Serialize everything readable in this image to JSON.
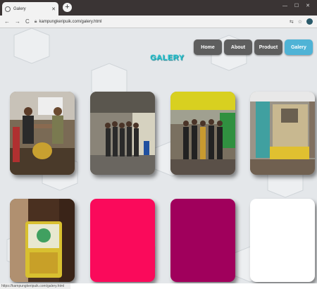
{
  "browser": {
    "tab_title": "Galery",
    "url": "kampungkeripuik.com/galery.html",
    "status_url": "https://kampungkeripuik.com/galery.html"
  },
  "nav": {
    "items": [
      {
        "label": "Home",
        "active": false
      },
      {
        "label": "About",
        "active": false
      },
      {
        "label": "Product",
        "active": false
      },
      {
        "label": "Galery",
        "active": true
      }
    ]
  },
  "page": {
    "title": "GALERY"
  },
  "gallery": {
    "items": [
      {
        "kind": "photo",
        "subject": "handshake-photo"
      },
      {
        "kind": "photo",
        "subject": "group-photo"
      },
      {
        "kind": "photo",
        "subject": "group-photo-2"
      },
      {
        "kind": "photo",
        "subject": "shop-photo"
      },
      {
        "kind": "photo",
        "subject": "product-package-photo"
      },
      {
        "kind": "color",
        "color": "#fa0a5b"
      },
      {
        "kind": "color",
        "color": "#a0005c"
      },
      {
        "kind": "color",
        "color": "#ffffff"
      }
    ]
  }
}
